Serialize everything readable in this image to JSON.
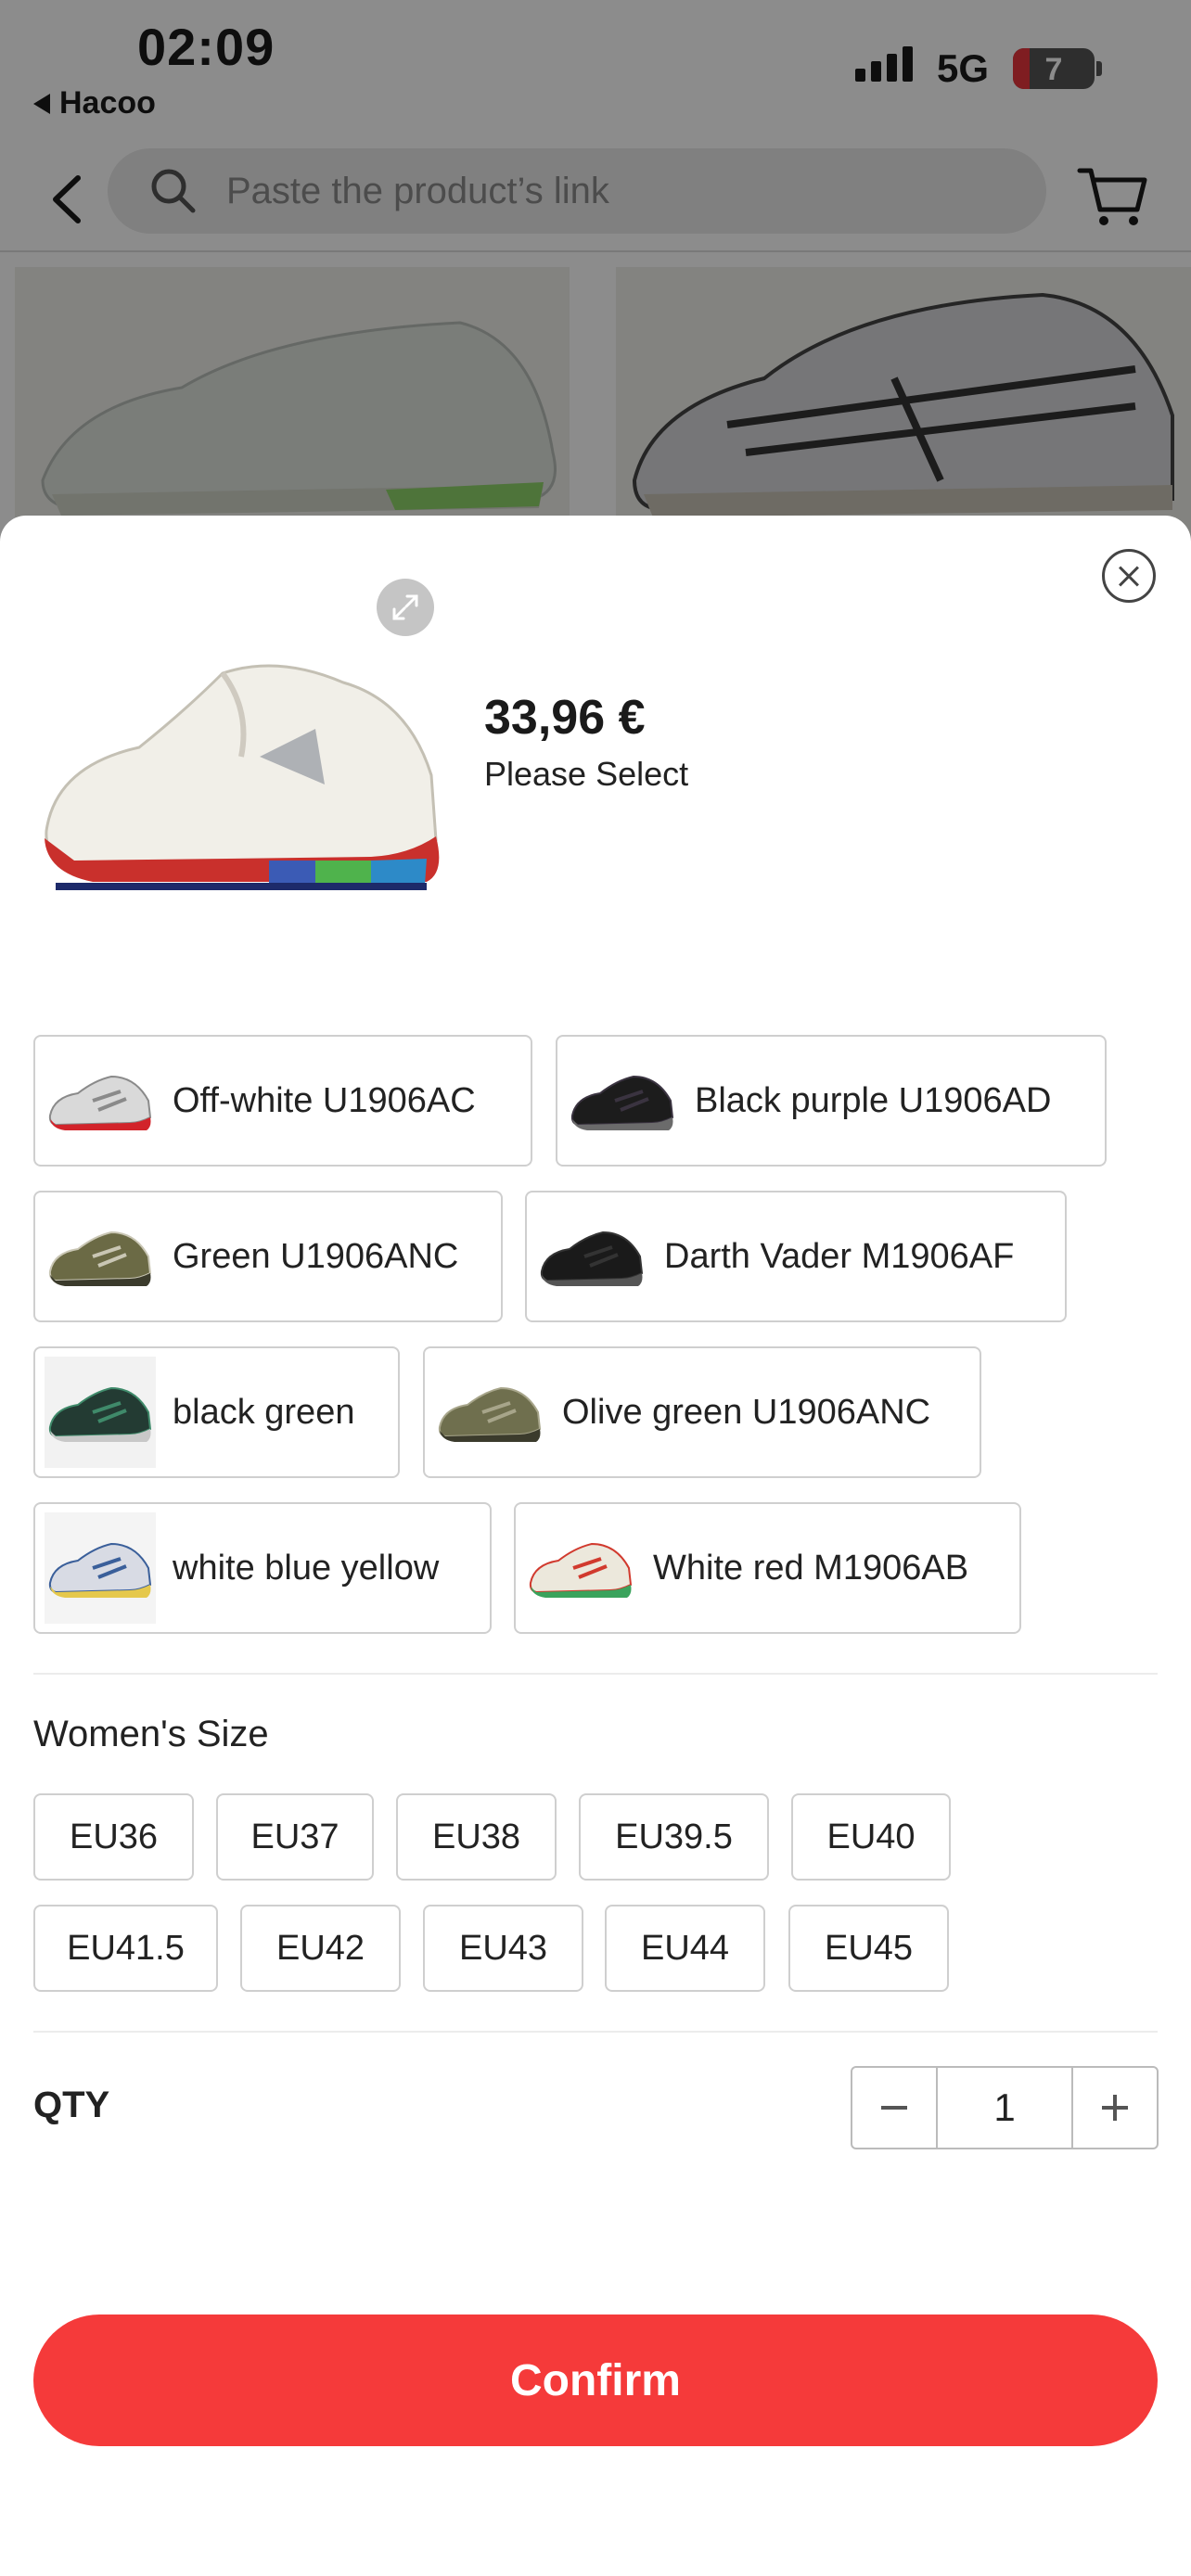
{
  "status_bar": {
    "time": "02:09",
    "back_app": "Hacoo",
    "network": "5G",
    "battery": "7"
  },
  "search": {
    "placeholder": "Paste the product’s link"
  },
  "icons": {
    "back": "chevron-left-icon",
    "search": "search-icon",
    "cart": "cart-icon",
    "close": "close-icon",
    "expand": "expand-icon",
    "minus": "minus-icon",
    "plus": "plus-icon"
  },
  "product": {
    "price": "33,96 €",
    "select_hint": "Please Select"
  },
  "variants": [
    {
      "label": "Off-white U1906AC",
      "colors": [
        "#d9d9d9",
        "#8a8a8a",
        "#d2232a"
      ]
    },
    {
      "label": "Black purple U1906AD",
      "colors": [
        "#1c1c1c",
        "#3a3340",
        "#6b6b6b"
      ]
    },
    {
      "label": "Green U1906ANC",
      "colors": [
        "#6b6a45",
        "#c9c6b4",
        "#3b3b2c"
      ]
    },
    {
      "label": "Darth Vader M1906AF",
      "colors": [
        "#1a1a1a",
        "#333333",
        "#555555"
      ]
    },
    {
      "label": "black green",
      "colors": [
        "#233b33",
        "#3f8a6a",
        "#c8c8c8"
      ]
    },
    {
      "label": "Olive green U1906ANC",
      "colors": [
        "#6f6f4e",
        "#a7a58a",
        "#3b3b2c"
      ]
    },
    {
      "label": "white blue yellow",
      "colors": [
        "#d8dbe4",
        "#3a5f9a",
        "#e5c84c"
      ]
    },
    {
      "label": "White red M1906AB",
      "colors": [
        "#ece8dc",
        "#d13a2e",
        "#3aa35c"
      ]
    }
  ],
  "sizes": {
    "title": "Women's Size",
    "options": [
      "EU36",
      "EU37",
      "EU38",
      "EU39.5",
      "EU40",
      "EU41.5",
      "EU42",
      "EU43",
      "EU44",
      "EU45"
    ]
  },
  "quantity": {
    "label": "QTY",
    "value": "1"
  },
  "confirm_label": "Confirm",
  "colors": {
    "accent": "#f53a3a"
  }
}
